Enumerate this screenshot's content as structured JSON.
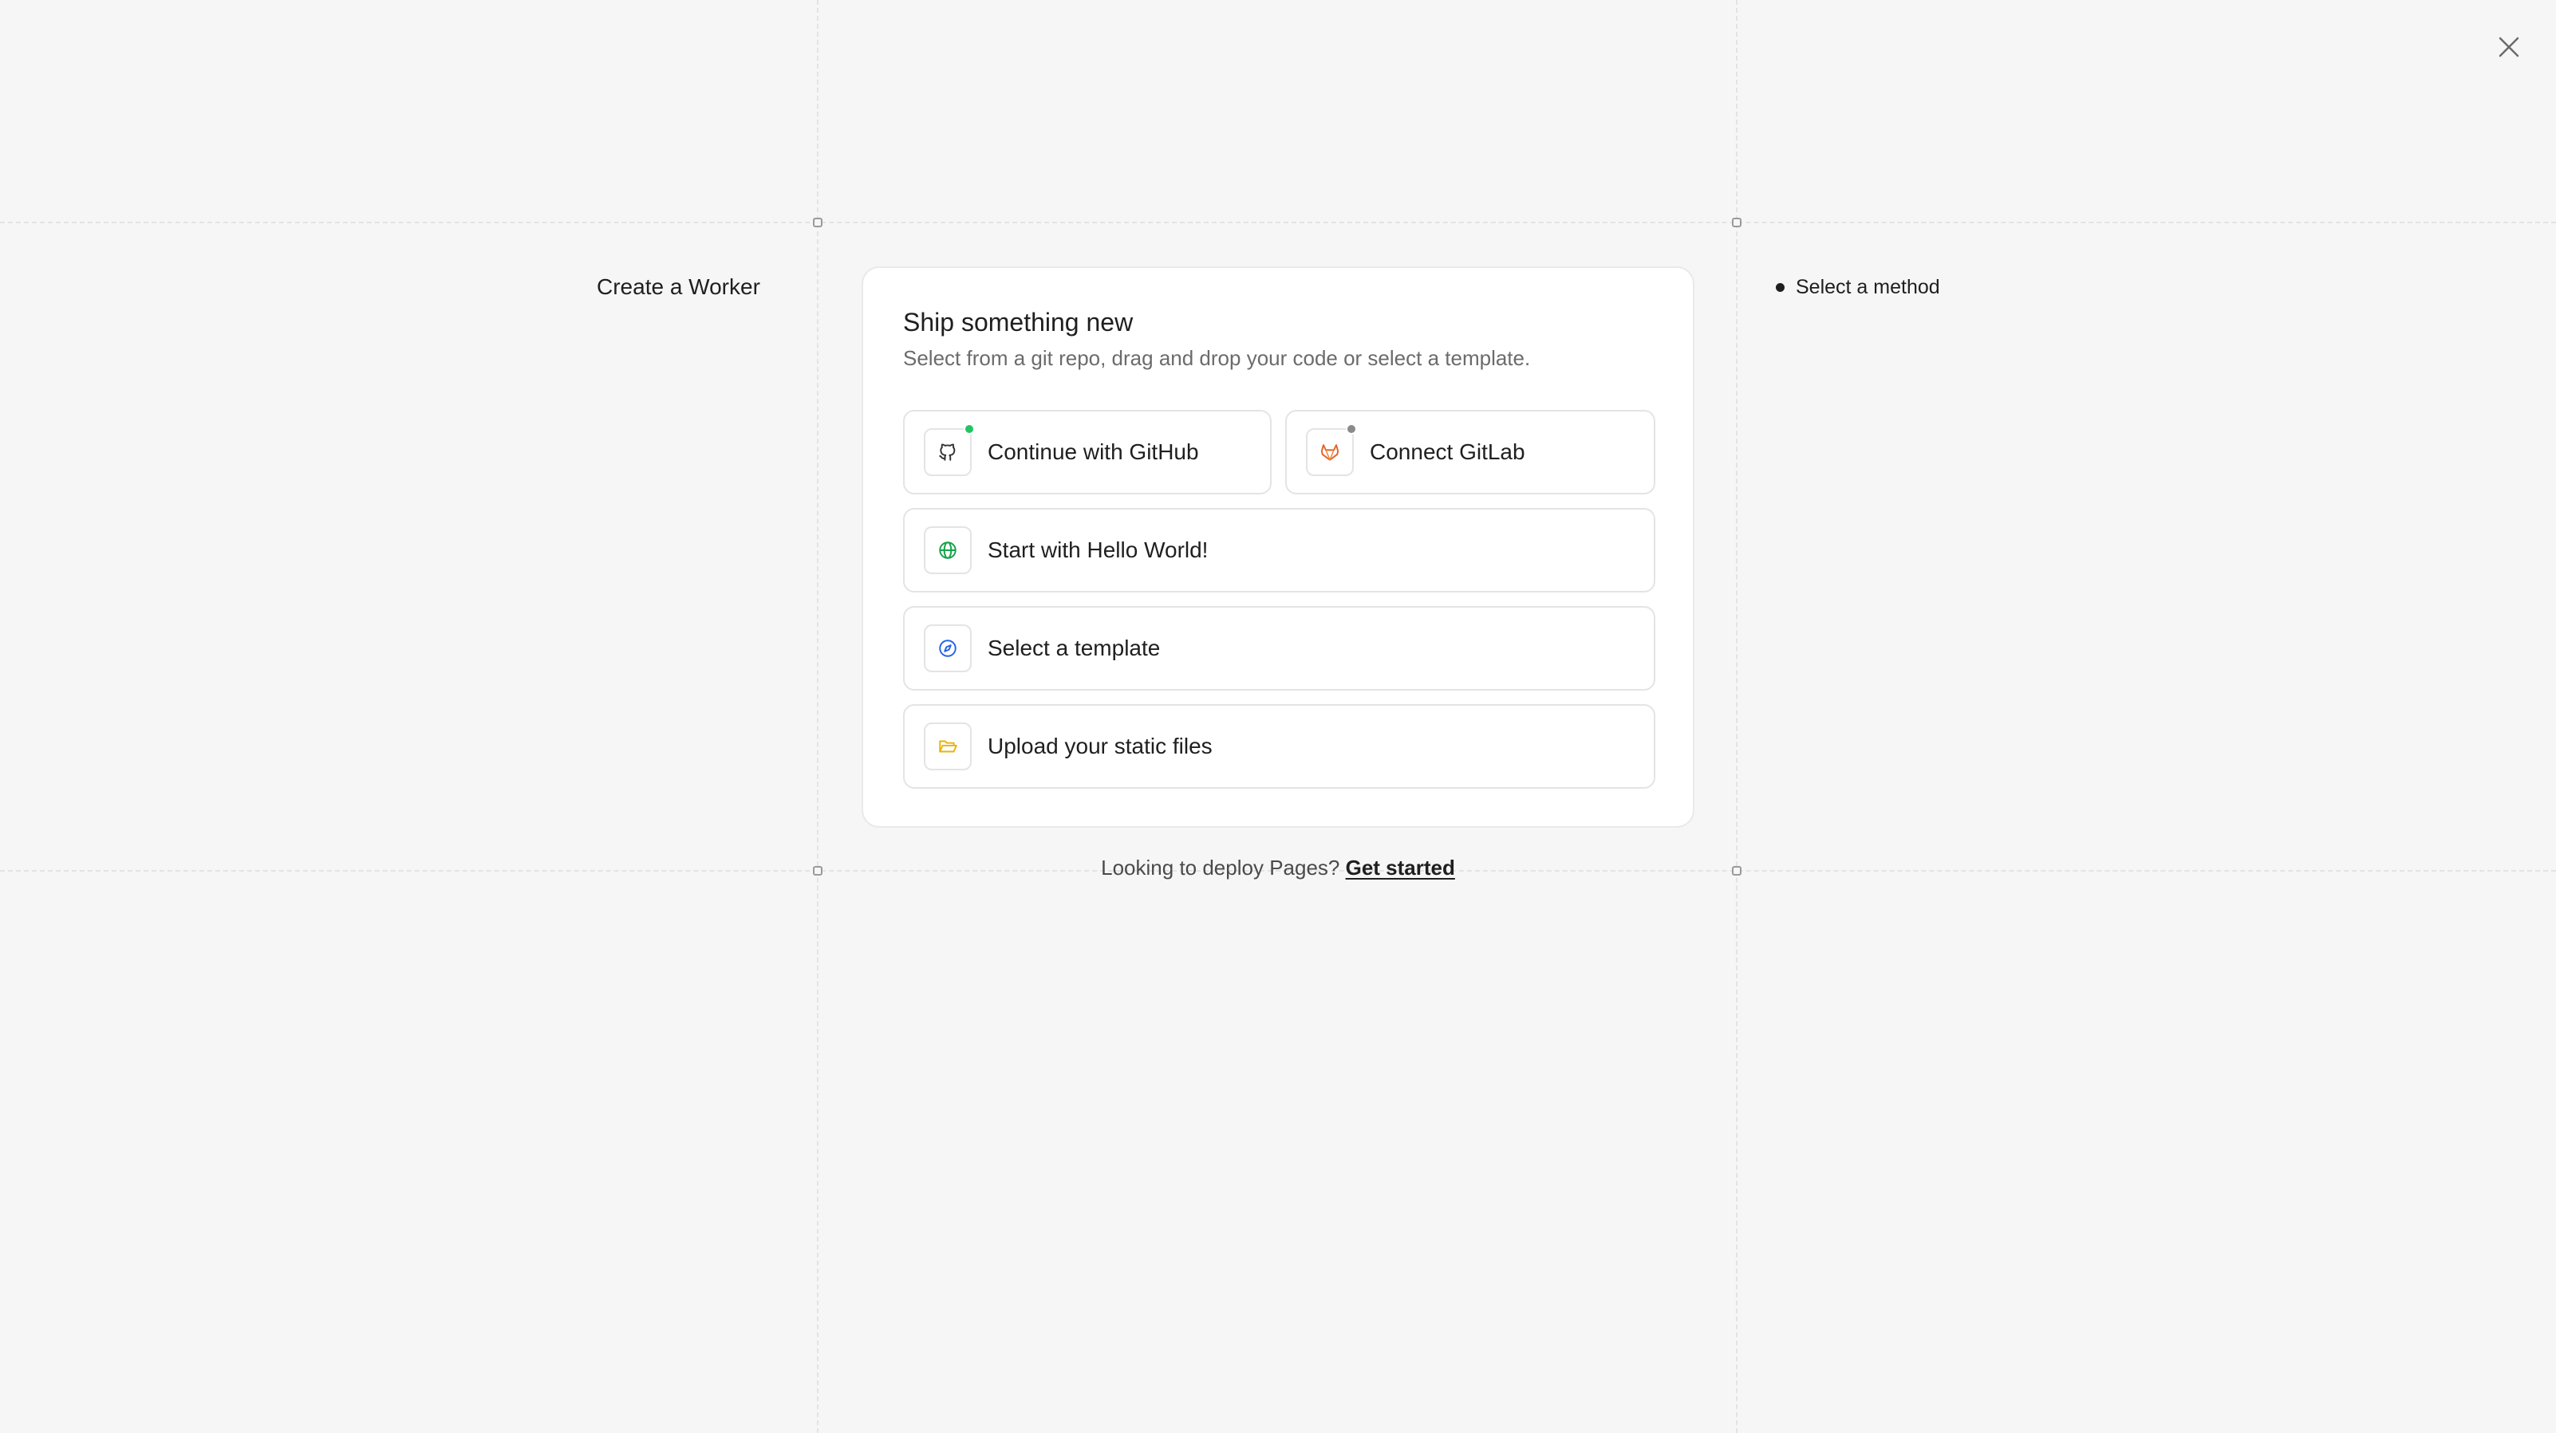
{
  "page": {
    "left_title": "Create a Worker",
    "steps": [
      {
        "label": "Select a method"
      }
    ]
  },
  "card": {
    "title": "Ship something new",
    "subtitle": "Select from a git repo, drag and drop your code or select a template."
  },
  "options": {
    "github": {
      "label": "Continue with GitHub",
      "icon": "github-icon",
      "status_color": "#22c55e"
    },
    "gitlab": {
      "label": "Connect GitLab",
      "icon": "gitlab-icon",
      "status_color": "#8a8a8a"
    },
    "hello_world": {
      "label": "Start with Hello World!",
      "icon": "globe-icon",
      "icon_color": "#16a34a"
    },
    "template": {
      "label": "Select a template",
      "icon": "compass-icon",
      "icon_color": "#2563eb"
    },
    "upload": {
      "label": "Upload your static files",
      "icon": "folder-icon",
      "icon_color": "#eab308"
    }
  },
  "footer": {
    "text": "Looking to deploy Pages? ",
    "link": "Get started"
  },
  "colors": {
    "background": "#f6f6f6",
    "card": "#ffffff",
    "border": "#e4e4e4",
    "text": "#1f1f1f",
    "muted": "#6b6b6b",
    "gitlab_orange": "#e2632a"
  }
}
